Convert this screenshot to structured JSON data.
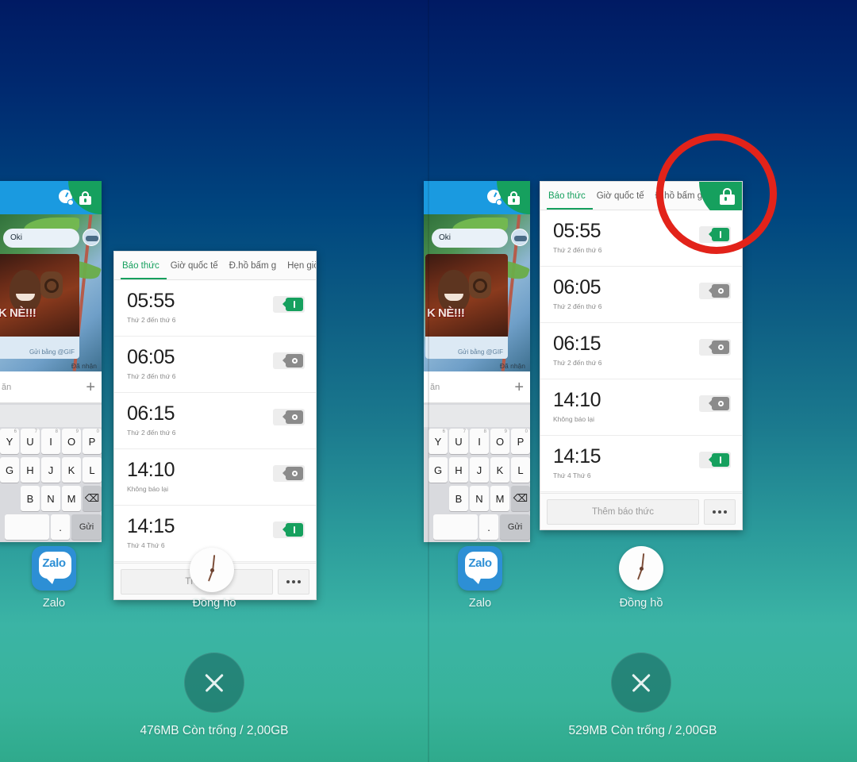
{
  "screen": {
    "kind": "android-recent-apps",
    "background_top_color": "#001a63",
    "background_bottom_color": "#2faa8c",
    "accent_green": "#16a05e",
    "highlight_color": "#e2231a"
  },
  "panels": [
    {
      "id": "left",
      "memory_text": "476MB Còn trống / 2,00GB",
      "has_highlight": false,
      "clock_icon_overlaps_card": true
    },
    {
      "id": "right",
      "memory_text": "529MB Còn trống / 2,00GB",
      "has_highlight": true,
      "clock_icon_overlaps_card": false
    }
  ],
  "zalo_card": {
    "app_label": "Zalo",
    "icon_name": "zalo-app-icon",
    "icon_text": "Zalo",
    "appbar": {
      "icons": [
        "clock-timer-icon",
        "phone-call-icon",
        "lock-icon"
      ],
      "lock_state": "locked"
    },
    "chat": {
      "incoming_message": "Oki",
      "gif_caption": "K NÈ!!!",
      "gif_source": "Gửi bằng @GIF",
      "delivery_status": "Đã nhận"
    },
    "input": {
      "placeholder": "ăn",
      "attach_icon": "plus-icon"
    },
    "keyboard": {
      "row1": [
        "Y",
        "U",
        "I",
        "O",
        "P"
      ],
      "row1_sup": [
        "6",
        "7",
        "8",
        "9",
        "0"
      ],
      "row2": [
        "G",
        "H",
        "J",
        "K",
        "L"
      ],
      "row3": [
        "B",
        "N",
        "M"
      ],
      "backspace_icon": "backspace-icon",
      "period_key": ".",
      "send_key": "Gửi"
    }
  },
  "clock_card": {
    "app_label": "Đồng hồ",
    "icon_name": "clock-app-icon",
    "tabs": [
      {
        "label": "Báo thức",
        "active": true
      },
      {
        "label": "Giờ quốc tế",
        "active": false
      },
      {
        "label": "Đ.hồ bấm g",
        "active": false
      },
      {
        "label": "Hẹn giờ",
        "active": false
      }
    ],
    "lock_state": "locked",
    "alarms": [
      {
        "time": "05:55",
        "repeat": "Thứ 2 đến thứ 6",
        "enabled": true
      },
      {
        "time": "06:05",
        "repeat": "Thứ 2 đến thứ 6",
        "enabled": false
      },
      {
        "time": "06:15",
        "repeat": "Thứ 2 đến thứ 6",
        "enabled": false
      },
      {
        "time": "14:10",
        "repeat": "Không báo lại",
        "enabled": false
      },
      {
        "time": "14:15",
        "repeat": "Thứ 4 Thứ 6",
        "enabled": true
      }
    ],
    "add_alarm_label": "Thêm báo thức",
    "add_alarm_label_occluded": "Thêm",
    "more_icon": "more-options-icon"
  },
  "close_all": {
    "icon": "close-x-icon",
    "label": ""
  }
}
